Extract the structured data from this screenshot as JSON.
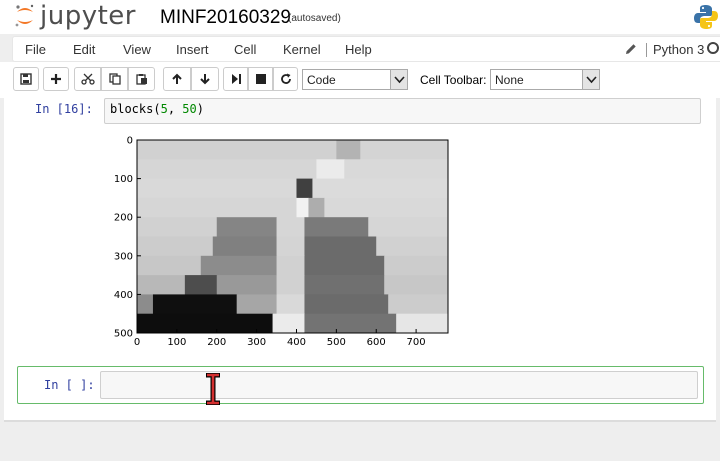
{
  "header": {
    "logo_text": "jupyter",
    "notebook_name": "MINF20160329",
    "autosave_status": "(autosaved)"
  },
  "menu": {
    "items": [
      "File",
      "Edit",
      "View",
      "Insert",
      "Cell",
      "Kernel",
      "Help"
    ],
    "kernel_name": "Python 3"
  },
  "toolbar": {
    "buttons": [
      "save-icon",
      "add-cell-icon",
      "cut-icon",
      "copy-icon",
      "paste-icon",
      "move-up-icon",
      "move-down-icon",
      "run-icon",
      "stop-icon",
      "restart-icon"
    ],
    "cell_type": "Code",
    "cell_toolbar_label": "Cell Toolbar:",
    "cell_toolbar_value": "None"
  },
  "cells": {
    "executed": {
      "prompt": "In [16]:",
      "code_fn": "blocks(",
      "code_arg1": "5",
      "code_sep": ", ",
      "code_arg2": "50",
      "code_end": ")"
    },
    "new": {
      "prompt": "In [ ]:"
    }
  },
  "chart_data": {
    "type": "heatmap",
    "colormap": "gray",
    "x_ticks": [
      "0",
      "100",
      "200",
      "300",
      "400",
      "500",
      "600",
      "700"
    ],
    "y_ticks": [
      "0",
      "100",
      "200",
      "300",
      "400",
      "500"
    ],
    "xlim": [
      0,
      780
    ],
    "ylim": [
      500,
      0
    ],
    "x_tick_values": [
      0,
      100,
      200,
      300,
      400,
      500,
      600,
      700
    ],
    "y_tick_values": [
      0,
      100,
      200,
      300,
      400,
      500
    ],
    "row_band_height": 50,
    "row_bands": [
      {
        "y": 0,
        "segments": [
          {
            "x0": 0,
            "x1": 500,
            "v": 0.82
          },
          {
            "x0": 500,
            "x1": 560,
            "v": 0.7
          },
          {
            "x0": 560,
            "x1": 780,
            "v": 0.83
          }
        ]
      },
      {
        "y": 50,
        "segments": [
          {
            "x0": 0,
            "x1": 450,
            "v": 0.84
          },
          {
            "x0": 450,
            "x1": 520,
            "v": 0.92
          },
          {
            "x0": 520,
            "x1": 780,
            "v": 0.85
          }
        ]
      },
      {
        "y": 100,
        "segments": [
          {
            "x0": 0,
            "x1": 400,
            "v": 0.85
          },
          {
            "x0": 400,
            "x1": 440,
            "v": 0.25
          },
          {
            "x0": 440,
            "x1": 780,
            "v": 0.86
          }
        ]
      },
      {
        "y": 150,
        "segments": [
          {
            "x0": 0,
            "x1": 400,
            "v": 0.84
          },
          {
            "x0": 400,
            "x1": 430,
            "v": 0.95
          },
          {
            "x0": 430,
            "x1": 470,
            "v": 0.68
          },
          {
            "x0": 470,
            "x1": 780,
            "v": 0.85
          }
        ]
      },
      {
        "y": 200,
        "segments": [
          {
            "x0": 0,
            "x1": 200,
            "v": 0.82
          },
          {
            "x0": 200,
            "x1": 350,
            "v": 0.52
          },
          {
            "x0": 350,
            "x1": 420,
            "v": 0.84
          },
          {
            "x0": 420,
            "x1": 580,
            "v": 0.48
          },
          {
            "x0": 580,
            "x1": 780,
            "v": 0.84
          }
        ]
      },
      {
        "y": 250,
        "segments": [
          {
            "x0": 0,
            "x1": 190,
            "v": 0.8
          },
          {
            "x0": 190,
            "x1": 350,
            "v": 0.5
          },
          {
            "x0": 350,
            "x1": 420,
            "v": 0.83
          },
          {
            "x0": 420,
            "x1": 600,
            "v": 0.42
          },
          {
            "x0": 600,
            "x1": 780,
            "v": 0.82
          }
        ]
      },
      {
        "y": 300,
        "segments": [
          {
            "x0": 0,
            "x1": 160,
            "v": 0.78
          },
          {
            "x0": 160,
            "x1": 350,
            "v": 0.55
          },
          {
            "x0": 350,
            "x1": 420,
            "v": 0.82
          },
          {
            "x0": 420,
            "x1": 620,
            "v": 0.42
          },
          {
            "x0": 620,
            "x1": 780,
            "v": 0.8
          }
        ]
      },
      {
        "y": 350,
        "segments": [
          {
            "x0": 0,
            "x1": 120,
            "v": 0.72
          },
          {
            "x0": 120,
            "x1": 200,
            "v": 0.3
          },
          {
            "x0": 200,
            "x1": 350,
            "v": 0.6
          },
          {
            "x0": 350,
            "x1": 420,
            "v": 0.82
          },
          {
            "x0": 420,
            "x1": 620,
            "v": 0.44
          },
          {
            "x0": 620,
            "x1": 780,
            "v": 0.78
          }
        ]
      },
      {
        "y": 400,
        "segments": [
          {
            "x0": 0,
            "x1": 40,
            "v": 0.55
          },
          {
            "x0": 40,
            "x1": 250,
            "v": 0.06
          },
          {
            "x0": 250,
            "x1": 350,
            "v": 0.65
          },
          {
            "x0": 350,
            "x1": 420,
            "v": 0.85
          },
          {
            "x0": 420,
            "x1": 630,
            "v": 0.42
          },
          {
            "x0": 630,
            "x1": 780,
            "v": 0.8
          }
        ]
      },
      {
        "y": 450,
        "segments": [
          {
            "x0": 0,
            "x1": 340,
            "v": 0.05
          },
          {
            "x0": 340,
            "x1": 420,
            "v": 0.92
          },
          {
            "x0": 420,
            "x1": 650,
            "v": 0.45
          },
          {
            "x0": 650,
            "x1": 780,
            "v": 0.9
          }
        ]
      }
    ]
  }
}
